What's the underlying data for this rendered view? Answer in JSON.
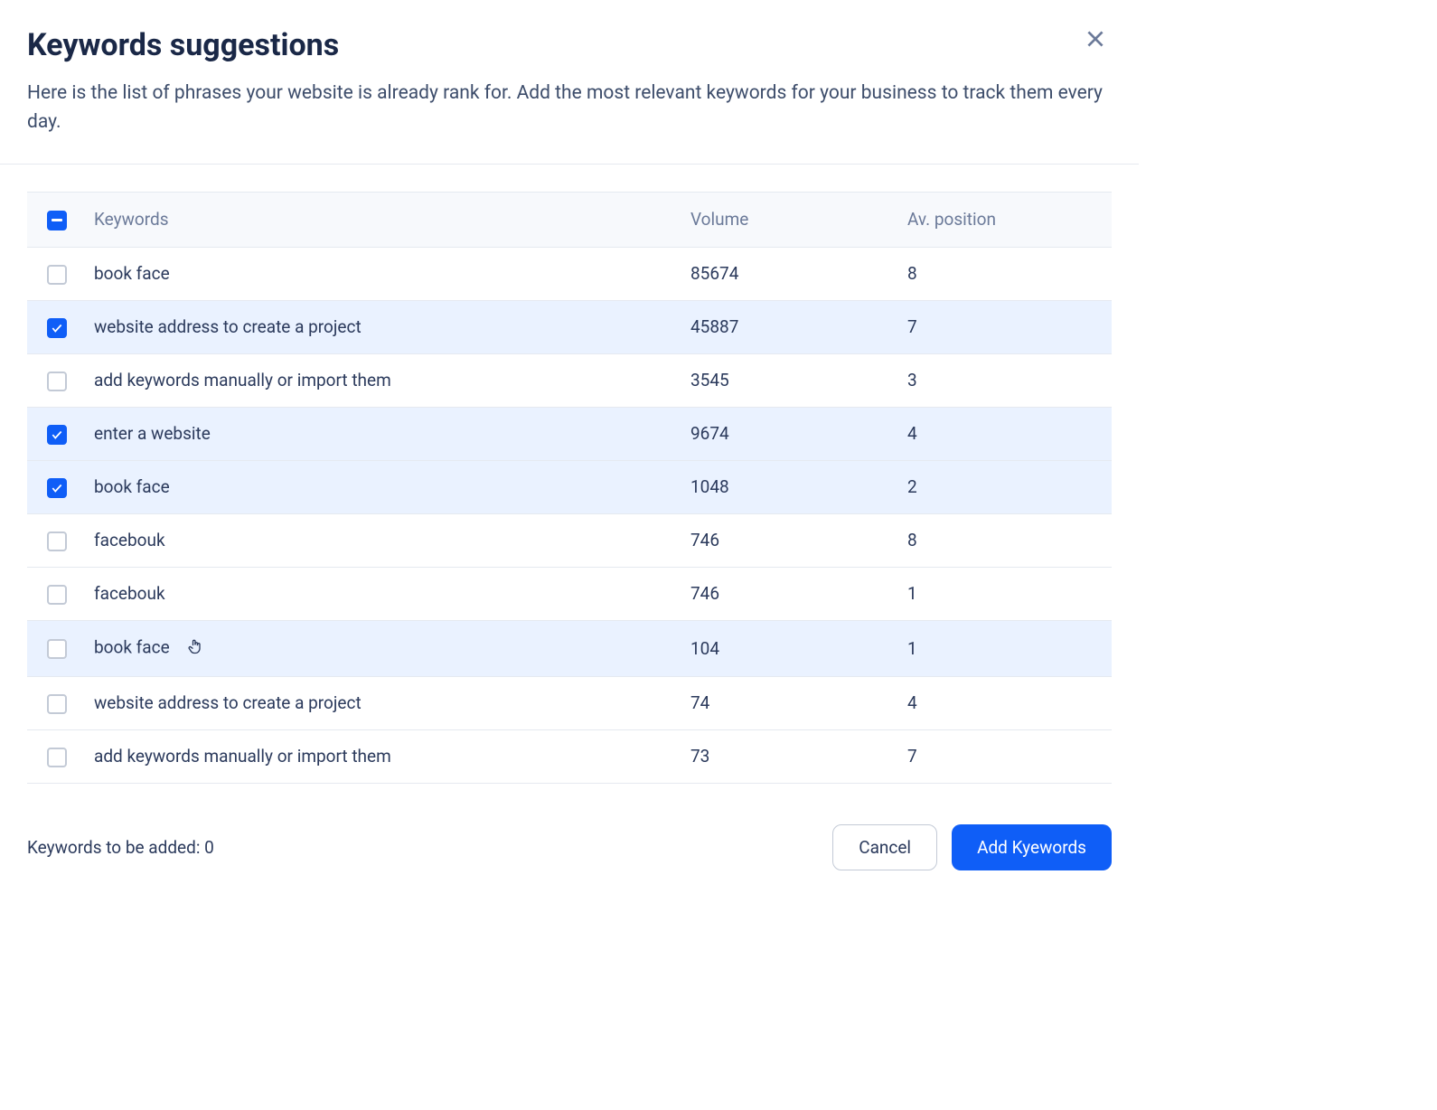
{
  "modal": {
    "title": "Keywords suggestions",
    "subtitle": "Here is the list of phrases your website is already rank for. Add the most relevant keywords for your business to track them every day."
  },
  "table": {
    "headers": {
      "keyword": "Keywords",
      "volume": "Volume",
      "position": "Av. position"
    },
    "rows": [
      {
        "keyword": "book face",
        "volume": "85674",
        "position": "8",
        "checked": false,
        "hovered": false
      },
      {
        "keyword": "website address to create a project",
        "volume": "45887",
        "position": "7",
        "checked": true,
        "hovered": false
      },
      {
        "keyword": "add keywords manually or import them",
        "volume": "3545",
        "position": "3",
        "checked": false,
        "hovered": false
      },
      {
        "keyword": "enter a website",
        "volume": "9674",
        "position": "4",
        "checked": true,
        "hovered": false
      },
      {
        "keyword": "book face",
        "volume": "1048",
        "position": "2",
        "checked": true,
        "hovered": false
      },
      {
        "keyword": "facebouk",
        "volume": "746",
        "position": "8",
        "checked": false,
        "hovered": false
      },
      {
        "keyword": "facebouk",
        "volume": "746",
        "position": "1",
        "checked": false,
        "hovered": false
      },
      {
        "keyword": "book face",
        "volume": "104",
        "position": "1",
        "checked": false,
        "hovered": true
      },
      {
        "keyword": "website address to create a project",
        "volume": "74",
        "position": "4",
        "checked": false,
        "hovered": false
      },
      {
        "keyword": "add keywords manually or import them",
        "volume": "73",
        "position": "7",
        "checked": false,
        "hovered": false
      }
    ],
    "header_checkbox_state": "indeterminate"
  },
  "footer": {
    "count_label": "Keywords to be added: 0",
    "cancel_label": "Cancel",
    "add_label": "Add Kyewords"
  }
}
